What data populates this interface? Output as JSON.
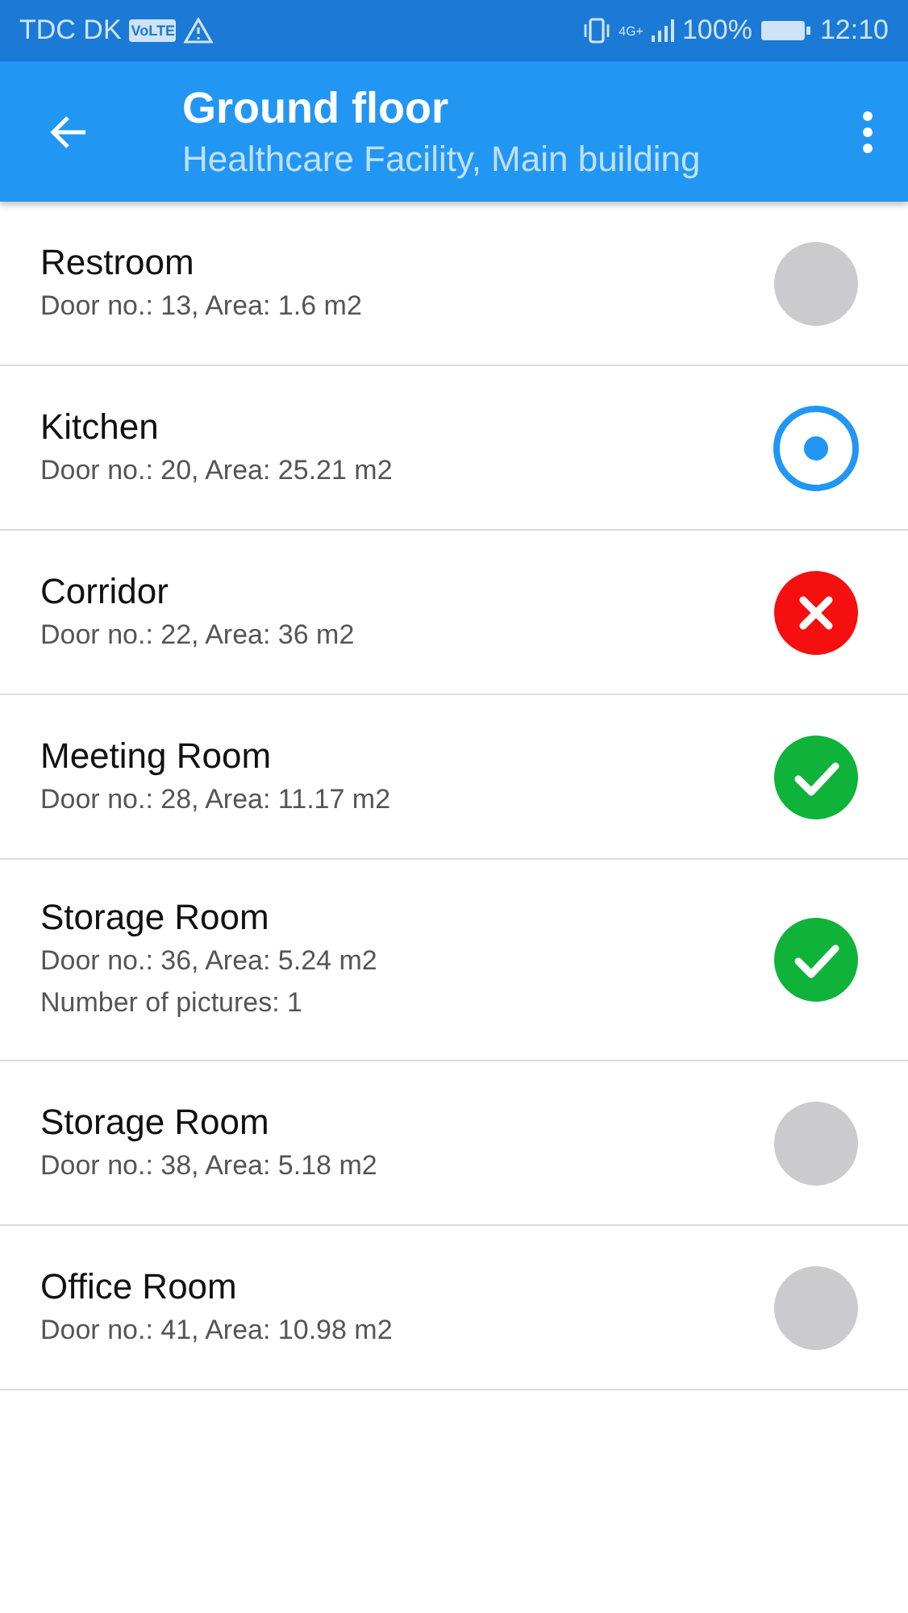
{
  "status_bar": {
    "carrier": "TDC DK",
    "network_badge": "VoLTE",
    "network_type": "4G+",
    "battery": "100%",
    "time": "12:10"
  },
  "app_bar": {
    "title": "Ground floor",
    "subtitle": "Healthcare Facility, Main building"
  },
  "rooms": [
    {
      "name": "Restroom",
      "details": [
        "Door no.: 13, Area: 1.6 m2"
      ],
      "kind": "pending"
    },
    {
      "name": "Kitchen",
      "details": [
        "Door no.: 20, Area: 25.21 m2"
      ],
      "kind": "selected"
    },
    {
      "name": "Corridor",
      "details": [
        "Door no.: 22, Area: 36 m2"
      ],
      "kind": "failed"
    },
    {
      "name": "Meeting Room",
      "details": [
        "Door no.: 28, Area: 11.17 m2"
      ],
      "kind": "done"
    },
    {
      "name": "Storage Room",
      "details": [
        "Door no.: 36, Area: 5.24 m2",
        "Number of pictures: 1"
      ],
      "kind": "done"
    },
    {
      "name": "Storage Room",
      "details": [
        "Door no.: 38, Area: 5.18 m2"
      ],
      "kind": "pending"
    },
    {
      "name": "Office Room",
      "details": [
        "Door no.: 41, Area: 10.98 m2"
      ],
      "kind": "pending"
    }
  ]
}
